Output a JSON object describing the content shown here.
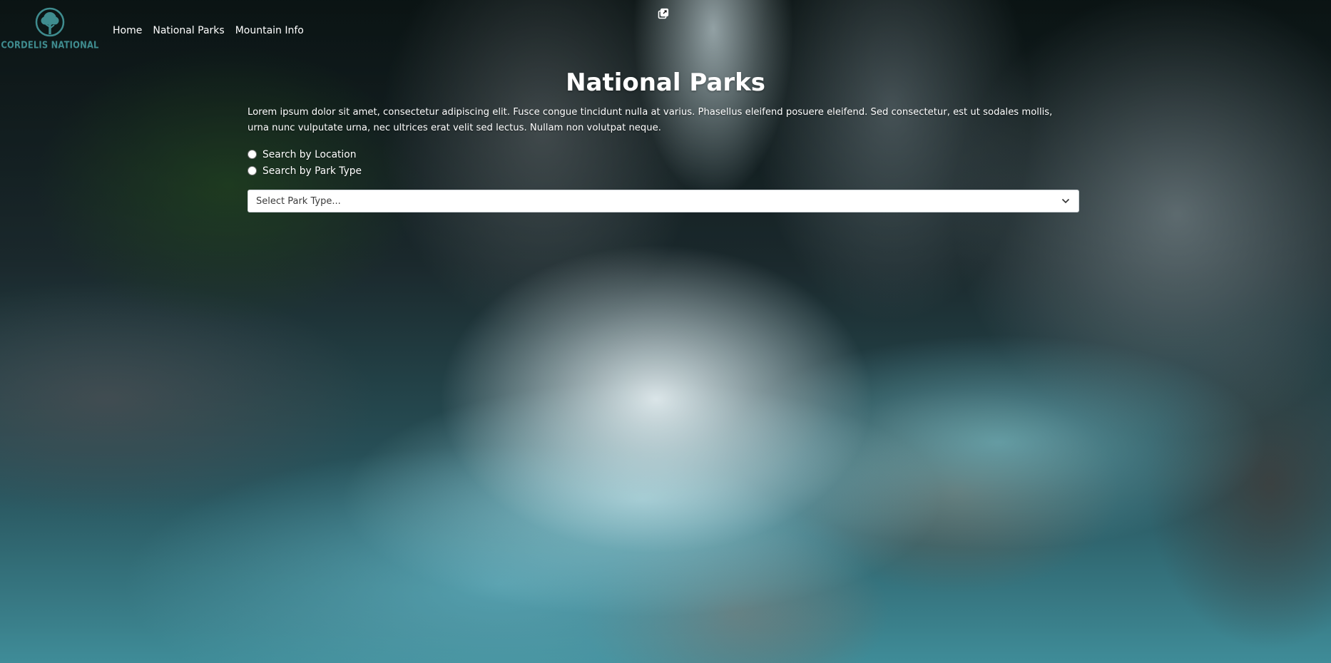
{
  "header": {
    "logo_text": "CORDELIS NATIONAL",
    "nav": [
      {
        "label": "Home"
      },
      {
        "label": "National Parks"
      },
      {
        "label": "Mountain Info"
      }
    ],
    "popout_icon": "external-window-icon"
  },
  "main": {
    "title": "National Parks",
    "intro": "Lorem ipsum dolor sit amet, consectetur adipiscing elit. Fusce congue tincidunt nulla at varius. Phasellus eleifend posuere eleifend. Sed consectetur, est ut sodales mollis, urna nunc vulputate urna, nec ultrices erat velit sed lectus. Nullam non volutpat neque.",
    "search_options": [
      {
        "label": "Search by Location",
        "selected": false
      },
      {
        "label": "Search by Park Type",
        "selected": false
      }
    ],
    "park_type_select": {
      "value": "Select Park Type...",
      "icon": "chevron-down-icon"
    }
  },
  "colors": {
    "logo": "#3f8c8f",
    "text": "#ffffff",
    "water": "#3f8c98"
  }
}
